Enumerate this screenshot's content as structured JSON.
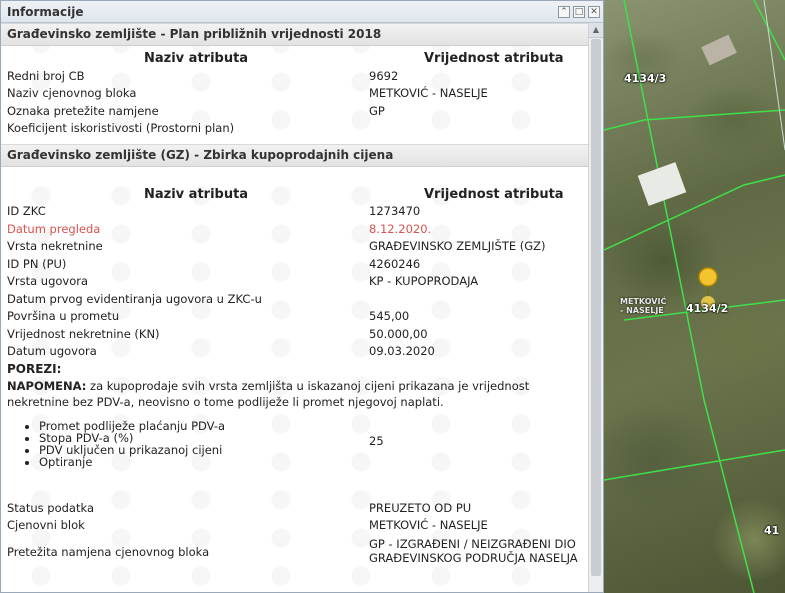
{
  "window": {
    "title": "Informacije"
  },
  "section1": {
    "title": "Građevinsko zemljište - Plan približnih vrijednosti 2018",
    "col_attr": "Naziv atributa",
    "col_val": "Vrijednost atributa",
    "rows": [
      {
        "attr": "Redni broj CB",
        "value": "9692"
      },
      {
        "attr": "Naziv cjenovnog bloka",
        "value": "METKOVIĆ - NASELJE"
      },
      {
        "attr": "Oznaka pretežite namjene",
        "value": "GP"
      },
      {
        "attr": "Koeficijent iskoristivosti (Prostorni plan)",
        "value": ""
      }
    ]
  },
  "section2": {
    "title": "Građevinsko zemljište (GZ) - Zbirka kupoprodajnih cijena",
    "col_attr": "Naziv atributa",
    "col_val": "Vrijednost atributa",
    "rows": [
      {
        "attr": "ID ZKC",
        "value": "1273470"
      },
      {
        "attr": "Datum pregleda",
        "value": "8.12.2020."
      },
      {
        "attr": "Vrsta nekretnine",
        "value": "GRAĐEVINSKO ZEMLJIŠTE (GZ)"
      },
      {
        "attr": "ID PN (PU)",
        "value": "4260246"
      },
      {
        "attr": "Vrsta ugovora",
        "value": "KP - KUPOPRODAJA"
      },
      {
        "attr": "Datum prvog evidentiranja ugovora u ZKC-u",
        "value": ""
      },
      {
        "attr": "Površina u prometu",
        "value": "545,00"
      },
      {
        "attr": "Vrijednost nekretnine (KN)",
        "value": "50.000,00"
      },
      {
        "attr": "Datum ugovora",
        "value": "09.03.2020"
      }
    ],
    "porezi_label": "POREZI:",
    "note_label": "NAPOMENA:",
    "note_text": " za kupoprodaje svih vrsta zemljišta u iskazanoj cijeni prikazana je vrijednost nekretnine bez PDV-a, neovisno o tome podliježe li promet njegovoj naplati.",
    "pdv_items": [
      "Promet podliježe plaćanju PDV-a",
      "Stopa PDV-a (%)",
      "PDV uključen u prikazanoj cijeni",
      "Optiranje"
    ],
    "pdv_rate": "25",
    "rows_after": [
      {
        "attr": "Status podatka",
        "value": "PREUZETO OD PU"
      },
      {
        "attr": "Cjenovni blok",
        "value": "METKOVIĆ - NASELJE"
      }
    ],
    "last_row": {
      "attr": "Pretežita namjena cjenovnog bloka",
      "value_line1": "GP - IZGRAĐENI / NEIZGRAĐENI DIO",
      "value_line2": "GRAĐEVINSKOG PODRUČJA NASELJA"
    }
  },
  "map": {
    "parcel_a": "4134/3",
    "parcel_b": "4134/2",
    "parcel_c": "41",
    "place_line1": "METKOVIĆ",
    "place_line2": "- NASELJE"
  },
  "colors": {
    "highlight_red": "#d9534f",
    "parcel_line": "#39d353"
  }
}
